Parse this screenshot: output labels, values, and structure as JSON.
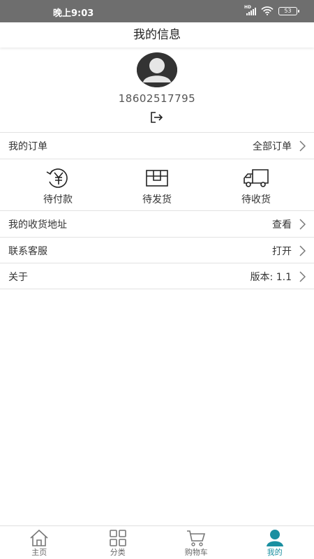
{
  "status_bar": {
    "time": "晚上9:03",
    "network": "HD",
    "battery": "53"
  },
  "header": {
    "title": "我的信息"
  },
  "profile": {
    "phone": "18602517795"
  },
  "orders_row": {
    "label": "我的订单",
    "action": "全部订单"
  },
  "order_status": [
    {
      "label": "待付款",
      "icon": "payment-yen-icon"
    },
    {
      "label": "待发货",
      "icon": "package-icon"
    },
    {
      "label": "待收货",
      "icon": "delivery-truck-icon"
    }
  ],
  "address_row": {
    "label": "我的收货地址",
    "action": "查看"
  },
  "service_row": {
    "label": "联系客服",
    "action": "打开"
  },
  "about_row": {
    "label": "关于",
    "action": "版本: 1.1"
  },
  "tabbar": {
    "items": [
      {
        "label": "主页",
        "icon": "home-icon"
      },
      {
        "label": "分类",
        "icon": "grid-icon"
      },
      {
        "label": "购物车",
        "icon": "cart-icon"
      },
      {
        "label": "我的",
        "icon": "user-icon"
      }
    ],
    "active_index": 3,
    "active_color": "#1a8fa0",
    "inactive_color": "#666666"
  }
}
